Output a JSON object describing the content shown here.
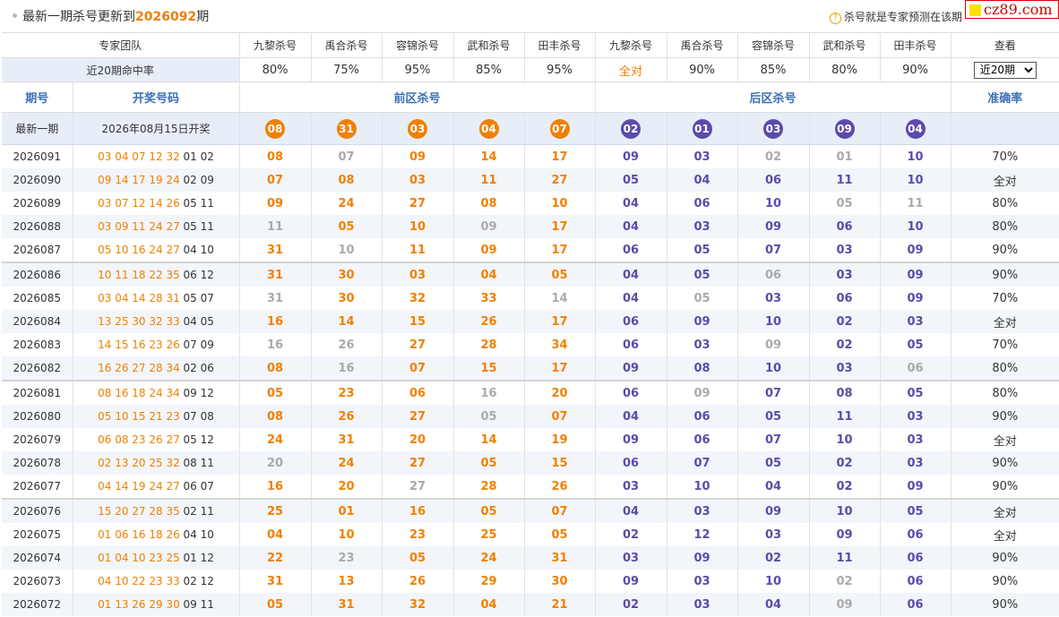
{
  "header": {
    "title_prefix": "最新一期杀号更新到",
    "title_period": "2026092",
    "title_suffix": "期",
    "notice_icon": "question-circle-icon",
    "notice": "杀号就是专家预测在该期"
  },
  "logo": {
    "text": "cz89.com"
  },
  "experts": {
    "team_label": "专家团队",
    "columns": [
      "九黎杀号",
      "禹合杀号",
      "容锦杀号",
      "武和杀号",
      "田丰杀号",
      "九黎杀号",
      "禹合杀号",
      "容锦杀号",
      "武和杀号",
      "田丰杀号"
    ],
    "view_label": "查看",
    "rate_label": "近20期命中率",
    "rates": [
      "80%",
      "75%",
      "95%",
      "85%",
      "95%",
      "全对",
      "90%",
      "85%",
      "80%",
      "90%"
    ],
    "select_value": "近20期"
  },
  "headings": {
    "period": "期号",
    "draw": "开奖号码",
    "front": "前区杀号",
    "back": "后区杀号",
    "accuracy": "准确率"
  },
  "latest": {
    "label": "最新一期",
    "date": "2026年08月15日开奖",
    "front": [
      "08",
      "31",
      "03",
      "04",
      "07"
    ],
    "back": [
      "02",
      "01",
      "03",
      "09",
      "04"
    ]
  },
  "rows": [
    {
      "period": "2026091",
      "front_draw": "03 04 07 12 32",
      "back_draw": "01 02",
      "kills": [
        [
          "08",
          "o"
        ],
        [
          "07",
          "g"
        ],
        [
          "09",
          "o"
        ],
        [
          "14",
          "o"
        ],
        [
          "17",
          "o"
        ],
        [
          "09",
          "b"
        ],
        [
          "03",
          "b"
        ],
        [
          "02",
          "g"
        ],
        [
          "01",
          "g"
        ],
        [
          "10",
          "b"
        ]
      ],
      "accuracy": "70%"
    },
    {
      "period": "2026090",
      "front_draw": "09 14 17 19 24",
      "back_draw": "02 09",
      "kills": [
        [
          "07",
          "o"
        ],
        [
          "08",
          "o"
        ],
        [
          "03",
          "o"
        ],
        [
          "11",
          "o"
        ],
        [
          "27",
          "o"
        ],
        [
          "05",
          "b"
        ],
        [
          "04",
          "b"
        ],
        [
          "06",
          "b"
        ],
        [
          "11",
          "b"
        ],
        [
          "10",
          "b"
        ]
      ],
      "accuracy": "全对"
    },
    {
      "period": "2026089",
      "front_draw": "03 07 12 14 26",
      "back_draw": "05 11",
      "kills": [
        [
          "09",
          "o"
        ],
        [
          "24",
          "o"
        ],
        [
          "27",
          "o"
        ],
        [
          "08",
          "o"
        ],
        [
          "10",
          "o"
        ],
        [
          "04",
          "b"
        ],
        [
          "06",
          "b"
        ],
        [
          "10",
          "b"
        ],
        [
          "05",
          "g"
        ],
        [
          "11",
          "g"
        ]
      ],
      "accuracy": "80%"
    },
    {
      "period": "2026088",
      "front_draw": "03 09 11 24 27",
      "back_draw": "05 11",
      "kills": [
        [
          "11",
          "g"
        ],
        [
          "05",
          "o"
        ],
        [
          "10",
          "o"
        ],
        [
          "09",
          "g"
        ],
        [
          "17",
          "o"
        ],
        [
          "04",
          "b"
        ],
        [
          "03",
          "b"
        ],
        [
          "09",
          "b"
        ],
        [
          "06",
          "b"
        ],
        [
          "10",
          "b"
        ]
      ],
      "accuracy": "80%"
    },
    {
      "period": "2026087",
      "front_draw": "05 10 16 24 27",
      "back_draw": "04 10",
      "kills": [
        [
          "31",
          "o"
        ],
        [
          "10",
          "g"
        ],
        [
          "11",
          "o"
        ],
        [
          "09",
          "o"
        ],
        [
          "17",
          "o"
        ],
        [
          "06",
          "b"
        ],
        [
          "05",
          "b"
        ],
        [
          "07",
          "b"
        ],
        [
          "03",
          "b"
        ],
        [
          "09",
          "b"
        ]
      ],
      "accuracy": "90%"
    },
    {
      "period": "2026086",
      "front_draw": "10 11 18 22 35",
      "back_draw": "06 12",
      "kills": [
        [
          "31",
          "o"
        ],
        [
          "30",
          "o"
        ],
        [
          "03",
          "o"
        ],
        [
          "04",
          "o"
        ],
        [
          "05",
          "o"
        ],
        [
          "04",
          "b"
        ],
        [
          "05",
          "b"
        ],
        [
          "06",
          "g"
        ],
        [
          "03",
          "b"
        ],
        [
          "09",
          "b"
        ]
      ],
      "accuracy": "90%"
    },
    {
      "period": "2026085",
      "front_draw": "03 04 14 28 31",
      "back_draw": "05 07",
      "kills": [
        [
          "31",
          "g"
        ],
        [
          "30",
          "o"
        ],
        [
          "32",
          "o"
        ],
        [
          "33",
          "o"
        ],
        [
          "14",
          "g"
        ],
        [
          "04",
          "b"
        ],
        [
          "05",
          "g"
        ],
        [
          "03",
          "b"
        ],
        [
          "06",
          "b"
        ],
        [
          "09",
          "b"
        ]
      ],
      "accuracy": "70%"
    },
    {
      "period": "2026084",
      "front_draw": "13 25 30 32 33",
      "back_draw": "04 05",
      "kills": [
        [
          "16",
          "o"
        ],
        [
          "14",
          "o"
        ],
        [
          "15",
          "o"
        ],
        [
          "26",
          "o"
        ],
        [
          "17",
          "o"
        ],
        [
          "06",
          "b"
        ],
        [
          "09",
          "b"
        ],
        [
          "10",
          "b"
        ],
        [
          "02",
          "b"
        ],
        [
          "03",
          "b"
        ]
      ],
      "accuracy": "全对"
    },
    {
      "period": "2026083",
      "front_draw": "14 15 16 23 26",
      "back_draw": "07 09",
      "kills": [
        [
          "16",
          "g"
        ],
        [
          "26",
          "g"
        ],
        [
          "27",
          "o"
        ],
        [
          "28",
          "o"
        ],
        [
          "34",
          "o"
        ],
        [
          "06",
          "b"
        ],
        [
          "03",
          "b"
        ],
        [
          "09",
          "g"
        ],
        [
          "02",
          "b"
        ],
        [
          "05",
          "b"
        ]
      ],
      "accuracy": "70%"
    },
    {
      "period": "2026082",
      "front_draw": "16 26 27 28 34",
      "back_draw": "02 06",
      "kills": [
        [
          "08",
          "o"
        ],
        [
          "16",
          "g"
        ],
        [
          "07",
          "o"
        ],
        [
          "15",
          "o"
        ],
        [
          "17",
          "o"
        ],
        [
          "09",
          "b"
        ],
        [
          "08",
          "b"
        ],
        [
          "10",
          "b"
        ],
        [
          "03",
          "b"
        ],
        [
          "06",
          "g"
        ]
      ],
      "accuracy": "80%"
    },
    {
      "period": "2026081",
      "front_draw": "08 16 18 24 34",
      "back_draw": "09 12",
      "kills": [
        [
          "05",
          "o"
        ],
        [
          "23",
          "o"
        ],
        [
          "06",
          "o"
        ],
        [
          "16",
          "g"
        ],
        [
          "20",
          "o"
        ],
        [
          "06",
          "b"
        ],
        [
          "09",
          "g"
        ],
        [
          "07",
          "b"
        ],
        [
          "08",
          "b"
        ],
        [
          "05",
          "b"
        ]
      ],
      "accuracy": "80%"
    },
    {
      "period": "2026080",
      "front_draw": "05 10 15 21 23",
      "back_draw": "07 08",
      "kills": [
        [
          "08",
          "o"
        ],
        [
          "26",
          "o"
        ],
        [
          "27",
          "o"
        ],
        [
          "05",
          "g"
        ],
        [
          "07",
          "o"
        ],
        [
          "04",
          "b"
        ],
        [
          "06",
          "b"
        ],
        [
          "05",
          "b"
        ],
        [
          "11",
          "b"
        ],
        [
          "03",
          "b"
        ]
      ],
      "accuracy": "90%"
    },
    {
      "period": "2026079",
      "front_draw": "06 08 23 26 27",
      "back_draw": "05 12",
      "kills": [
        [
          "24",
          "o"
        ],
        [
          "31",
          "o"
        ],
        [
          "20",
          "o"
        ],
        [
          "14",
          "o"
        ],
        [
          "19",
          "o"
        ],
        [
          "09",
          "b"
        ],
        [
          "06",
          "b"
        ],
        [
          "07",
          "b"
        ],
        [
          "10",
          "b"
        ],
        [
          "03",
          "b"
        ]
      ],
      "accuracy": "全对"
    },
    {
      "period": "2026078",
      "front_draw": "02 13 20 25 32",
      "back_draw": "08 11",
      "kills": [
        [
          "20",
          "g"
        ],
        [
          "24",
          "o"
        ],
        [
          "27",
          "o"
        ],
        [
          "05",
          "o"
        ],
        [
          "15",
          "o"
        ],
        [
          "06",
          "b"
        ],
        [
          "07",
          "b"
        ],
        [
          "05",
          "b"
        ],
        [
          "02",
          "b"
        ],
        [
          "03",
          "b"
        ]
      ],
      "accuracy": "90%"
    },
    {
      "period": "2026077",
      "front_draw": "04 14 19 24 27",
      "back_draw": "06 07",
      "kills": [
        [
          "16",
          "o"
        ],
        [
          "20",
          "o"
        ],
        [
          "27",
          "g"
        ],
        [
          "28",
          "o"
        ],
        [
          "26",
          "o"
        ],
        [
          "03",
          "b"
        ],
        [
          "10",
          "b"
        ],
        [
          "04",
          "b"
        ],
        [
          "02",
          "b"
        ],
        [
          "09",
          "b"
        ]
      ],
      "accuracy": "90%"
    },
    {
      "period": "2026076",
      "front_draw": "15 20 27 28 35",
      "back_draw": "02 11",
      "kills": [
        [
          "25",
          "o"
        ],
        [
          "01",
          "o"
        ],
        [
          "16",
          "o"
        ],
        [
          "05",
          "o"
        ],
        [
          "07",
          "o"
        ],
        [
          "04",
          "b"
        ],
        [
          "03",
          "b"
        ],
        [
          "09",
          "b"
        ],
        [
          "10",
          "b"
        ],
        [
          "05",
          "b"
        ]
      ],
      "accuracy": "全对"
    },
    {
      "period": "2026075",
      "front_draw": "01 06 16 18 26",
      "back_draw": "04 10",
      "kills": [
        [
          "04",
          "o"
        ],
        [
          "10",
          "o"
        ],
        [
          "23",
          "o"
        ],
        [
          "25",
          "o"
        ],
        [
          "05",
          "o"
        ],
        [
          "02",
          "b"
        ],
        [
          "12",
          "b"
        ],
        [
          "03",
          "b"
        ],
        [
          "09",
          "b"
        ],
        [
          "06",
          "b"
        ]
      ],
      "accuracy": "全对"
    },
    {
      "period": "2026074",
      "front_draw": "01 04 10 23 25",
      "back_draw": "01 12",
      "kills": [
        [
          "22",
          "o"
        ],
        [
          "23",
          "g"
        ],
        [
          "05",
          "o"
        ],
        [
          "24",
          "o"
        ],
        [
          "31",
          "o"
        ],
        [
          "03",
          "b"
        ],
        [
          "09",
          "b"
        ],
        [
          "02",
          "b"
        ],
        [
          "11",
          "b"
        ],
        [
          "06",
          "b"
        ]
      ],
      "accuracy": "90%"
    },
    {
      "period": "2026073",
      "front_draw": "04 10 22 23 33",
      "back_draw": "02 12",
      "kills": [
        [
          "31",
          "o"
        ],
        [
          "13",
          "o"
        ],
        [
          "26",
          "o"
        ],
        [
          "29",
          "o"
        ],
        [
          "30",
          "o"
        ],
        [
          "09",
          "b"
        ],
        [
          "03",
          "b"
        ],
        [
          "10",
          "b"
        ],
        [
          "02",
          "g"
        ],
        [
          "06",
          "b"
        ]
      ],
      "accuracy": "90%"
    },
    {
      "period": "2026072",
      "front_draw": "01 13 26 29 30",
      "back_draw": "09 11",
      "kills": [
        [
          "05",
          "o"
        ],
        [
          "31",
          "o"
        ],
        [
          "32",
          "o"
        ],
        [
          "04",
          "o"
        ],
        [
          "21",
          "o"
        ],
        [
          "02",
          "b"
        ],
        [
          "03",
          "b"
        ],
        [
          "04",
          "b"
        ],
        [
          "09",
          "g"
        ],
        [
          "06",
          "b"
        ]
      ],
      "accuracy": "90%"
    }
  ]
}
